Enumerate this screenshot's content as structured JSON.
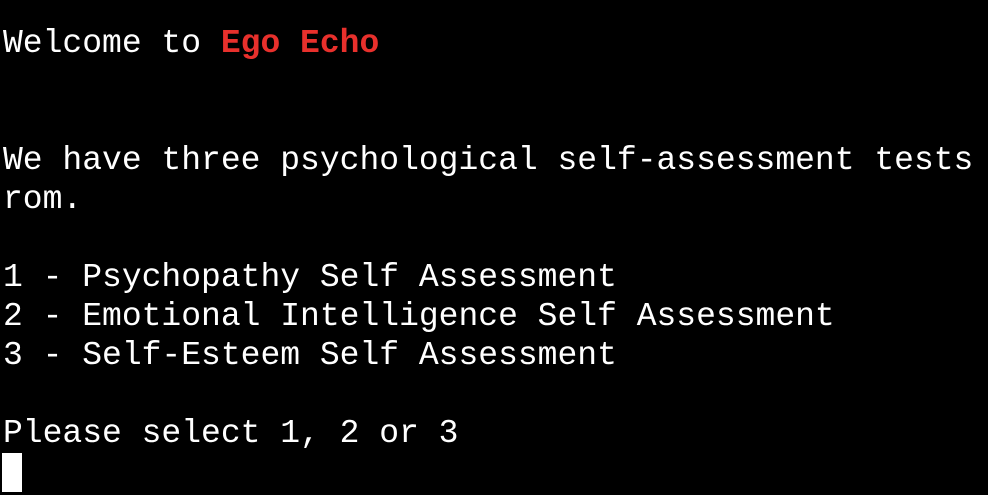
{
  "terminal": {
    "welcome_prefix": "Welcome to ",
    "app_name": "Ego Echo",
    "intro_line_1": "We have three psychological self-assessment tests",
    "intro_line_2": "rom.",
    "options": [
      "1 - Psychopathy Self Assessment",
      "2 - Emotional Intelligence Self Assessment",
      "3 - Self-Esteem Self Assessment"
    ],
    "prompt": "Please select 1, 2 or 3",
    "colors": {
      "background": "#000000",
      "text": "#ffffff",
      "brand": "#e8302c"
    }
  }
}
